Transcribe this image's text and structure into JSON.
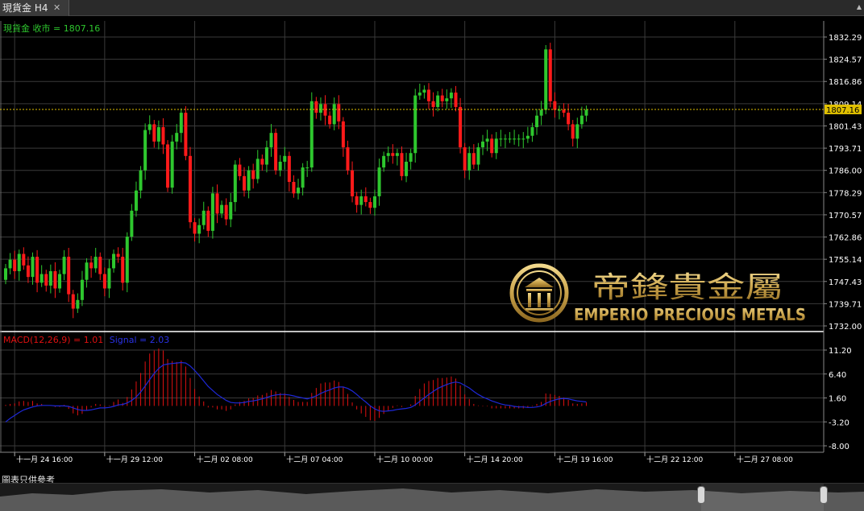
{
  "window": {
    "tab_title": "現貨金 H4",
    "close_glyph": "✕",
    "scroll_glyph": "▲"
  },
  "colors": {
    "up": "#2ec72e",
    "down": "#ff1a1a",
    "macd": "#e01010",
    "signal": "#1e28d8",
    "current": "#e0c000",
    "grid": "#3a3a3a",
    "axis_text": "#ffffff"
  },
  "chart_data": [
    {
      "type": "candlestick",
      "legend": "現貨金 收市 = 1807.16",
      "current_value_label": "1807.16",
      "current_value": 1807.16,
      "ylim": [
        1732.0,
        1836.0
      ],
      "yticks": [
        "1832.29",
        "1824.57",
        "1816.86",
        "1809.14",
        "1801.43",
        "1793.71",
        "1786.00",
        "1778.29",
        "1770.57",
        "1762.86",
        "1755.14",
        "1747.43",
        "1739.71",
        "1732.00"
      ],
      "close": [
        1752,
        1755,
        1751,
        1757,
        1753,
        1749,
        1756,
        1747,
        1750,
        1746,
        1751,
        1745,
        1750,
        1756,
        1743,
        1738,
        1741,
        1748,
        1754,
        1752,
        1756,
        1750,
        1745,
        1752,
        1757,
        1756,
        1747,
        1763,
        1772,
        1779,
        1786,
        1800,
        1802,
        1796,
        1801,
        1795,
        1780,
        1796,
        1799,
        1806,
        1791,
        1768,
        1764,
        1767,
        1772,
        1765,
        1778,
        1771,
        1774,
        1769,
        1775,
        1788,
        1784,
        1779,
        1786,
        1783,
        1790,
        1788,
        1794,
        1799,
        1786,
        1789,
        1791,
        1782,
        1778,
        1780,
        1787,
        1787,
        1810,
        1806,
        1809,
        1805,
        1802,
        1809,
        1803,
        1794,
        1786,
        1777,
        1774,
        1777,
        1775,
        1773,
        1777,
        1787,
        1791,
        1792,
        1791,
        1792,
        1784,
        1789,
        1792,
        1812,
        1813,
        1814,
        1810,
        1808,
        1812,
        1810,
        1811,
        1813,
        1808,
        1794,
        1786,
        1792,
        1788,
        1794,
        1796,
        1797,
        1792,
        1797,
        1797,
        1797,
        1797,
        1797,
        1797,
        1797,
        1798,
        1801,
        1805,
        1807,
        1828,
        1810,
        1807,
        1807,
        1806,
        1802,
        1797,
        1802,
        1805,
        1807
      ],
      "open": [
        1748,
        1752,
        1755,
        1751,
        1757,
        1753,
        1749,
        1756,
        1747,
        1750,
        1746,
        1751,
        1745,
        1750,
        1756,
        1743,
        1738,
        1741,
        1748,
        1754,
        1752,
        1756,
        1750,
        1745,
        1752,
        1757,
        1756,
        1747,
        1763,
        1772,
        1779,
        1786,
        1800,
        1802,
        1796,
        1801,
        1795,
        1780,
        1796,
        1799,
        1806,
        1791,
        1768,
        1764,
        1767,
        1772,
        1765,
        1778,
        1771,
        1774,
        1769,
        1775,
        1788,
        1784,
        1779,
        1786,
        1783,
        1790,
        1788,
        1794,
        1799,
        1786,
        1789,
        1791,
        1782,
        1778,
        1780,
        1787,
        1787,
        1810,
        1806,
        1809,
        1805,
        1802,
        1809,
        1803,
        1794,
        1786,
        1777,
        1774,
        1777,
        1775,
        1773,
        1777,
        1787,
        1791,
        1792,
        1791,
        1792,
        1784,
        1789,
        1792,
        1812,
        1813,
        1814,
        1810,
        1808,
        1812,
        1810,
        1811,
        1813,
        1808,
        1794,
        1786,
        1792,
        1788,
        1794,
        1796,
        1797,
        1792,
        1797,
        1797,
        1797,
        1797,
        1797,
        1797,
        1797,
        1798,
        1801,
        1805,
        1807,
        1828,
        1810,
        1807,
        1807,
        1806,
        1802,
        1797,
        1802,
        1805
      ],
      "macd": [
        0.2,
        0.4,
        0.5,
        0.9,
        1.0,
        0.8,
        1.0,
        0.5,
        0.4,
        0.0,
        0.1,
        -0.2,
        -0.2,
        0.2,
        -0.6,
        -1.5,
        -1.9,
        -1.6,
        -0.8,
        -0.3,
        0.4,
        0.3,
        -0.2,
        0.1,
        0.8,
        1.3,
        0.6,
        1.8,
        3.3,
        4.9,
        6.6,
        8.9,
        10.5,
        11.1,
        11.5,
        11.1,
        9.4,
        9.0,
        8.8,
        9.1,
        7.9,
        5.6,
        3.4,
        1.9,
        0.9,
        -0.3,
        -0.3,
        -0.7,
        -0.7,
        -1.0,
        -0.7,
        0.3,
        0.8,
        1.0,
        1.5,
        1.6,
        2.1,
        2.2,
        2.6,
        3.2,
        2.9,
        2.6,
        2.5,
        1.8,
        1.2,
        0.8,
        0.8,
        0.8,
        2.6,
        3.6,
        4.5,
        4.7,
        4.7,
        5.1,
        4.8,
        3.7,
        2.4,
        0.7,
        -0.7,
        -1.5,
        -2.2,
        -2.9,
        -3.0,
        -2.4,
        -1.6,
        -0.9,
        -0.4,
        0.1,
        -0.2,
        0.0,
        0.3,
        2.0,
        3.4,
        4.5,
        5.0,
        5.2,
        5.6,
        5.6,
        5.7,
        5.9,
        5.5,
        4.1,
        2.3,
        1.4,
        0.4,
        0.1,
        -0.1,
        -0.1,
        -0.5,
        -0.5,
        -0.5,
        -0.5,
        -0.5,
        -0.5,
        -0.5,
        -0.5,
        -0.4,
        -0.1,
        0.4,
        0.8,
        2.5,
        2.4,
        2.2,
        2.0,
        1.7,
        1.2,
        0.5,
        0.4,
        0.5,
        0.7
      ],
      "signal": [
        -3.2,
        -2.5,
        -1.9,
        -1.3,
        -0.8,
        -0.5,
        -0.2,
        0.0,
        0.1,
        0.1,
        0.1,
        0.0,
        0.0,
        0.0,
        -0.1,
        -0.4,
        -0.7,
        -0.9,
        -0.9,
        -0.8,
        -0.6,
        -0.4,
        -0.4,
        -0.3,
        -0.1,
        0.2,
        0.3,
        0.6,
        1.1,
        1.8,
        2.8,
        4.0,
        5.3,
        6.5,
        7.5,
        8.2,
        8.4,
        8.5,
        8.6,
        8.7,
        8.6,
        8.0,
        7.1,
        6.1,
        5.0,
        3.9,
        3.1,
        2.3,
        1.7,
        1.1,
        0.7,
        0.6,
        0.6,
        0.7,
        0.9,
        1.0,
        1.2,
        1.4,
        1.7,
        2.0,
        2.2,
        2.3,
        2.3,
        2.2,
        2.0,
        1.8,
        1.6,
        1.4,
        1.7,
        2.0,
        2.5,
        2.9,
        3.2,
        3.6,
        3.8,
        3.8,
        3.5,
        3.0,
        2.3,
        1.5,
        0.8,
        0.0,
        -0.6,
        -1.0,
        -1.1,
        -1.0,
        -0.9,
        -0.7,
        -0.6,
        -0.5,
        -0.3,
        0.2,
        0.9,
        1.6,
        2.3,
        2.9,
        3.5,
        3.9,
        4.3,
        4.6,
        4.8,
        4.6,
        4.1,
        3.6,
        2.9,
        2.3,
        1.8,
        1.4,
        1.0,
        0.7,
        0.4,
        0.2,
        0.1,
        -0.1,
        -0.2,
        -0.2,
        -0.3,
        -0.3,
        -0.2,
        0.0,
        0.5,
        0.9,
        1.2,
        1.4,
        1.5,
        1.4,
        1.2,
        1.0,
        0.9,
        0.8
      ]
    },
    {
      "type": "macd",
      "legend_macd": "MACD(12,26,9) = 1.01",
      "legend_signal": "Signal = 2.03",
      "ylim": [
        -8.0,
        13.0
      ],
      "yticks": [
        "11.20",
        "6.40",
        "1.60",
        "-3.20",
        "-8.00"
      ]
    }
  ],
  "x_axis": {
    "labels": [
      "十一月 24 16:00",
      "十一月 29 12:00",
      "十二月 02 08:00",
      "十二月 07 04:00",
      "十二月 10 00:00",
      "十二月 14 20:00",
      "十二月 19 16:00",
      "十二月 22 12:00",
      "十二月 27 08:00"
    ],
    "label_bars": [
      2,
      22,
      42,
      62,
      82,
      102,
      122,
      142,
      162
    ]
  },
  "footer": {
    "disclaimer": "圖表只供參考"
  },
  "watermark": {
    "chinese": "帝鋒貴金屬",
    "english": "EMPERIO PRECIOUS METALS"
  }
}
